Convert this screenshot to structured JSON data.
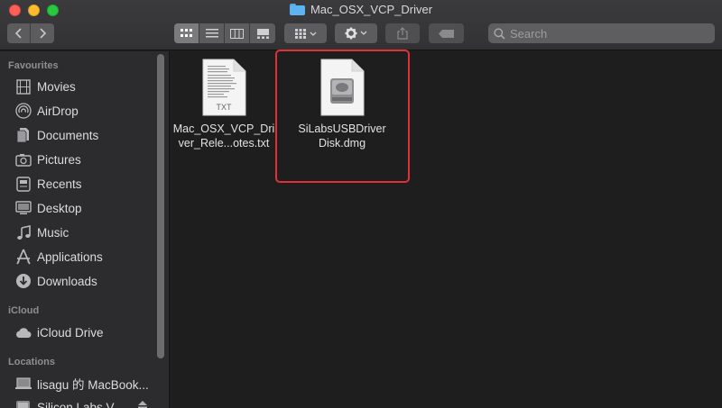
{
  "window": {
    "title": "Mac_OSX_VCP_Driver"
  },
  "toolbar": {
    "icons": [
      "chevron-left-icon",
      "chevron-right-icon",
      "icon-view-icon",
      "list-view-icon",
      "column-view-icon",
      "gallery-view-icon",
      "group-by-icon",
      "gear-icon",
      "share-icon",
      "tag-icon",
      "search-icon"
    ]
  },
  "search": {
    "placeholder": "Search"
  },
  "sidebar": {
    "favourites_title": "Favourites",
    "favourites": [
      {
        "label": "Movies",
        "icon": "movies-icon"
      },
      {
        "label": "AirDrop",
        "icon": "airdrop-icon"
      },
      {
        "label": "Documents",
        "icon": "documents-icon"
      },
      {
        "label": "Pictures",
        "icon": "pictures-icon"
      },
      {
        "label": "Recents",
        "icon": "recents-icon"
      },
      {
        "label": "Desktop",
        "icon": "desktop-icon"
      },
      {
        "label": "Music",
        "icon": "music-icon"
      },
      {
        "label": "Applications",
        "icon": "applications-icon"
      },
      {
        "label": "Downloads",
        "icon": "downloads-icon"
      }
    ],
    "icloud_title": "iCloud",
    "icloud": [
      {
        "label": "iCloud Drive",
        "icon": "cloud-icon"
      }
    ],
    "locations_title": "Locations",
    "locations": [
      {
        "label": "lisagu 的 MacBook...",
        "icon": "laptop-icon"
      },
      {
        "label": "Silicon Labs V...",
        "icon": "disk-icon"
      }
    ]
  },
  "files": [
    {
      "name_line1": "Mac_OSX_VCP_Dri",
      "name_line2": "ver_Rele...otes.txt",
      "type_badge": "TXT",
      "icon": "text-file-icon"
    },
    {
      "name_line1": "SiLabsUSBDriver",
      "name_line2": "Disk.dmg",
      "icon": "disk-image-icon",
      "highlighted": true
    }
  ],
  "colors": {
    "highlight": "#e0303a",
    "folder": "#5eb3f1"
  }
}
